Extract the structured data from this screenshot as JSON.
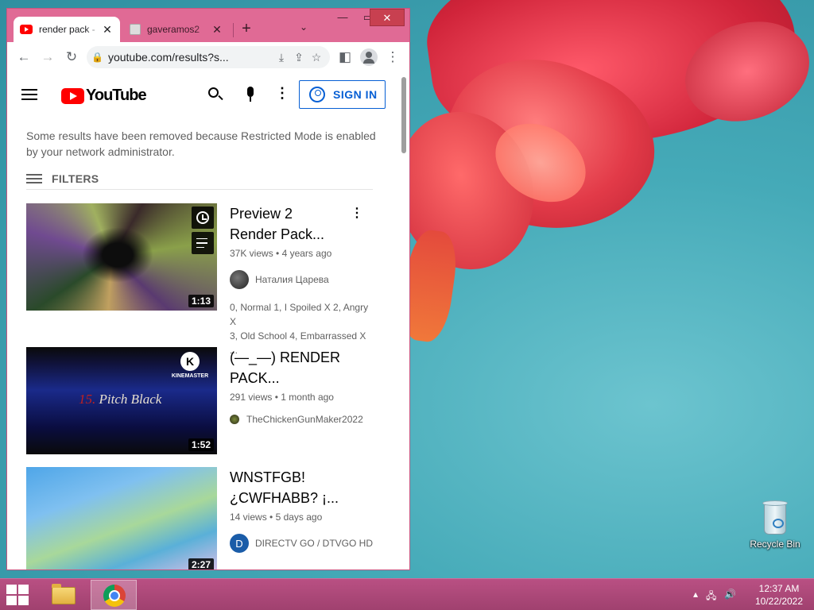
{
  "browser": {
    "tabs": [
      {
        "title": "render pack -",
        "active": true
      },
      {
        "title": "gaveramos2",
        "active": false
      }
    ],
    "url": "youtube.com/results?s..."
  },
  "youtube": {
    "logo_text": "YouTube",
    "sign_in_label": "SIGN IN",
    "restricted_notice": "Some results have been removed because Restricted Mode is enabled by your network administrator.",
    "filters_label": "FILTERS",
    "videos": [
      {
        "title_line1": "Preview 2",
        "title_line2": "Render Pack...",
        "views": "37K views",
        "age": "4 years ago",
        "channel": "Наталия Царева",
        "description_line1": "0, Normal 1, I Spoiled X 2, Angry X",
        "description_line2": "3, Old School 4, Embarrassed X ...",
        "duration": "1:13"
      },
      {
        "title_line1": "(—_—) RENDER",
        "title_line2": "PACK...",
        "views": "291 views",
        "age": "1 month ago",
        "channel": "TheChickenGunMaker2022",
        "duration": "1:52",
        "thumb_watermark": "KINEMASTER",
        "thumb_text_num": "15.",
        "thumb_text": "Pitch Black"
      },
      {
        "title_line1": "WNSTFGB!",
        "title_line2": "¿CWFHABB? ¡...",
        "views": "14 views",
        "age": "5 days ago",
        "channel": "DIRECTV GO / DTVGO HD",
        "channel_initial": "D",
        "duration": "2:27"
      }
    ]
  },
  "desktop": {
    "recycle_bin_label": "Recycle Bin"
  },
  "taskbar": {
    "time": "12:37 AM",
    "date": "10/22/2022"
  }
}
